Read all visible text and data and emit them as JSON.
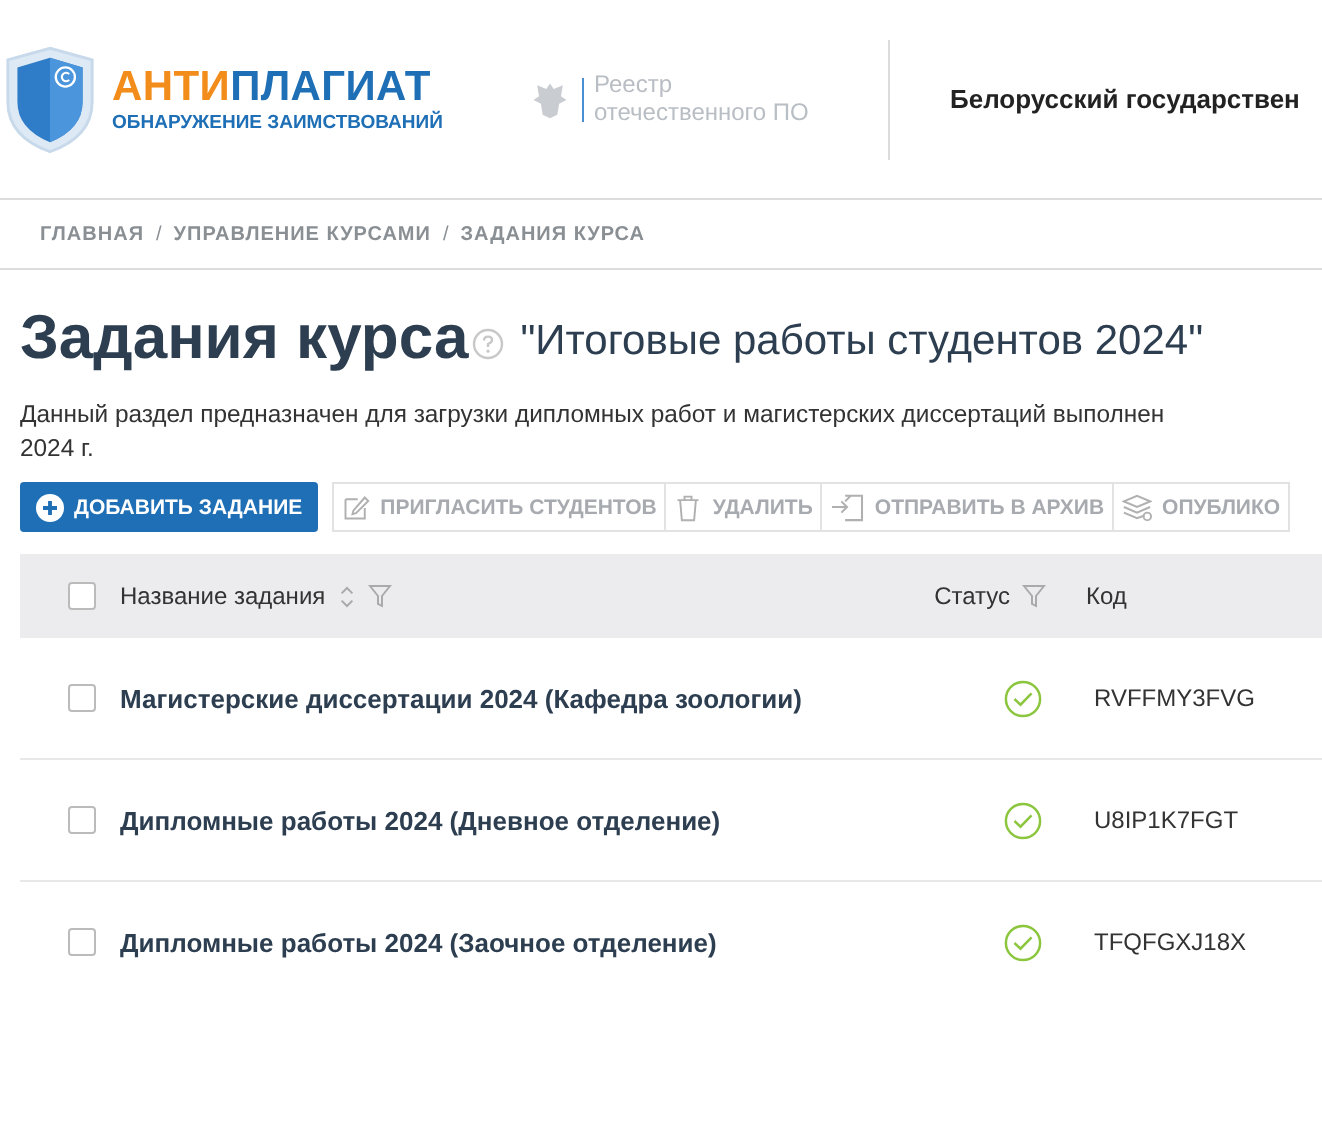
{
  "header": {
    "logo": {
      "title_accent": "АНТИ",
      "title_main": "ПЛАГИАТ",
      "subtitle": "ОБНАРУЖЕНИЕ ЗАИМСТВОВАНИЙ"
    },
    "registry": [
      "Реестр",
      "отечественного ПО"
    ],
    "organization": "Белорусский государствен"
  },
  "breadcrumbs": [
    "ГЛАВНАЯ",
    "УПРАВЛЕНИЕ КУРСАМИ",
    "ЗАДАНИЯ КУРСА"
  ],
  "breadcrumb_separator": "/",
  "page": {
    "title": "Задания курса",
    "course_name": "\"Итоговые работы студентов 2024\"",
    "description": "Данный раздел предназначен для загрузки дипломных работ и магистерских диссертаций выполнен",
    "description_line_2": "2024 г."
  },
  "toolbar": [
    {
      "label": "ДОБАВИТЬ ЗАДАНИЕ",
      "kind": "primary"
    },
    {
      "label": "ПРИГЛАСИТЬ СТУДЕНТОВ",
      "kind": "secondary"
    },
    {
      "label": "УДАЛИТЬ",
      "kind": "secondary"
    },
    {
      "label": "ОТПРАВИТЬ В АРХИВ",
      "kind": "secondary"
    },
    {
      "label": "ОПУБЛИКО",
      "kind": "secondary"
    }
  ],
  "table": {
    "select_all_checked": false,
    "columns": [
      "Название задания",
      "Статус",
      "Код"
    ],
    "rows": [
      {
        "checked": false,
        "name": "Магистерские диссертации 2024 (Кафедра зоологии)",
        "completed": true,
        "code": "RVFFMY3FVG"
      },
      {
        "checked": false,
        "name": "Дипломные работы 2024 (Дневное отделение)",
        "completed": true,
        "code": "U8IP1K7FGT"
      },
      {
        "checked": false,
        "name": "Дипломные работы 2024 (Заочное отделение)",
        "completed": true,
        "code": "TFQFGXJ18X"
      }
    ]
  }
}
